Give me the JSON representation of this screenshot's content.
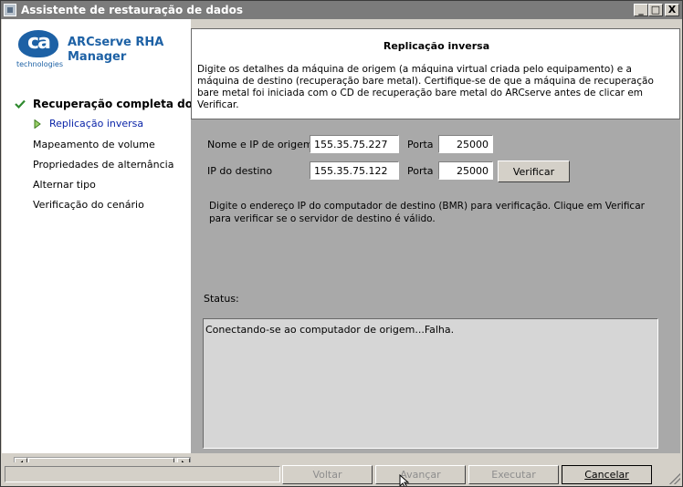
{
  "window": {
    "title": "Assistente de restauração de dados",
    "controls": {
      "minimize": "_",
      "maximize": "□",
      "close": "X"
    }
  },
  "brand": {
    "logo_text": "ca",
    "logo_subtext": "technologies",
    "product_line1": "ARCserve RHA",
    "product_line2": "Manager"
  },
  "steps": [
    {
      "label": "Recuperação completa do siste",
      "state": "completed",
      "icon": "check-icon"
    },
    {
      "label": "Replicação inversa",
      "state": "current",
      "icon": "arrow-right-icon"
    },
    {
      "label": "Mapeamento de volume",
      "state": "pending"
    },
    {
      "label": "Propriedades de alternância",
      "state": "pending"
    },
    {
      "label": "Alternar tipo",
      "state": "pending"
    },
    {
      "label": "Verificação do cenário",
      "state": "pending"
    }
  ],
  "header": {
    "title": "Replicação inversa",
    "description": "Digite os detalhes da máquina de origem (a máquina virtual criada pelo equipamento) e a máquina de destino (recuperação bare metal). Certifique-se de que a máquina de recuperação bare metal foi iniciada com o CD de recuperação bare metal do ARCserve antes de clicar em Verificar."
  },
  "form": {
    "source_label": "Nome e IP de origem",
    "source_value": "155.35.75.227",
    "source_port_label": "Porta",
    "source_port_value": "25000",
    "dest_label": "IP do destino",
    "dest_value": "155.35.75.122",
    "dest_port_label": "Porta",
    "dest_port_value": "25000",
    "verify_label": "Verificar",
    "hint": "Digite o endereço IP do computador de destino (BMR) para verificação. Clique em Verificar para verificar se o servidor de destino é válido."
  },
  "status": {
    "label": "Status:",
    "text": "Conectando-se ao computador de origem...Falha."
  },
  "buttons": {
    "back": {
      "label": "Voltar",
      "enabled": false
    },
    "next": {
      "label": "Avançar",
      "enabled": false
    },
    "run": {
      "label": "Executar",
      "enabled": false
    },
    "cancel": {
      "label": "Cancelar",
      "enabled": true
    }
  },
  "colors": {
    "accent": "#1d61a5",
    "current_step": "#0a24a8",
    "check": "#2f8a2f",
    "titlebar": "#7b7b7b"
  }
}
